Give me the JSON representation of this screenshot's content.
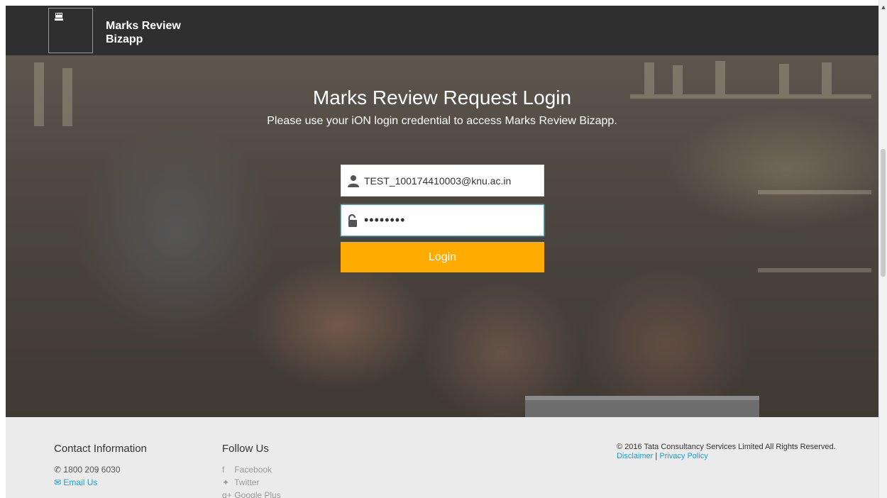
{
  "header": {
    "brand_line1": "Marks Review",
    "brand_line2": "Bizapp",
    "logo_icon": "building-icon",
    "background": "#2f2f2f"
  },
  "hero": {
    "title": "Marks Review Request Login",
    "subtitle": "Please use your iON login credential to access Marks Review Bizapp."
  },
  "login": {
    "username_value": "TEST_100174410003@knu.ac.in",
    "username_icon": "user-icon",
    "password_value": "••••••••",
    "password_icon": "unlock-icon",
    "button_label": "Login",
    "button_color": "#ffab00"
  },
  "footer": {
    "contact": {
      "heading": "Contact Information",
      "phone": "1800 209 6030",
      "email_label": "Email Us"
    },
    "follow": {
      "heading": "Follow Us",
      "items": [
        {
          "label": "Facebook",
          "icon": "facebook-icon"
        },
        {
          "label": "Twitter",
          "icon": "twitter-icon"
        },
        {
          "label": "Google Plus",
          "icon": "google-plus-icon"
        }
      ]
    },
    "copyright": "© 2016 Tata Consultancy Services Limited All Rights Reserved.",
    "disclaimer_label": "Disclaimer",
    "separator": "|",
    "privacy_label": "Privacy Policy",
    "link_color": "#1aa0d8"
  }
}
